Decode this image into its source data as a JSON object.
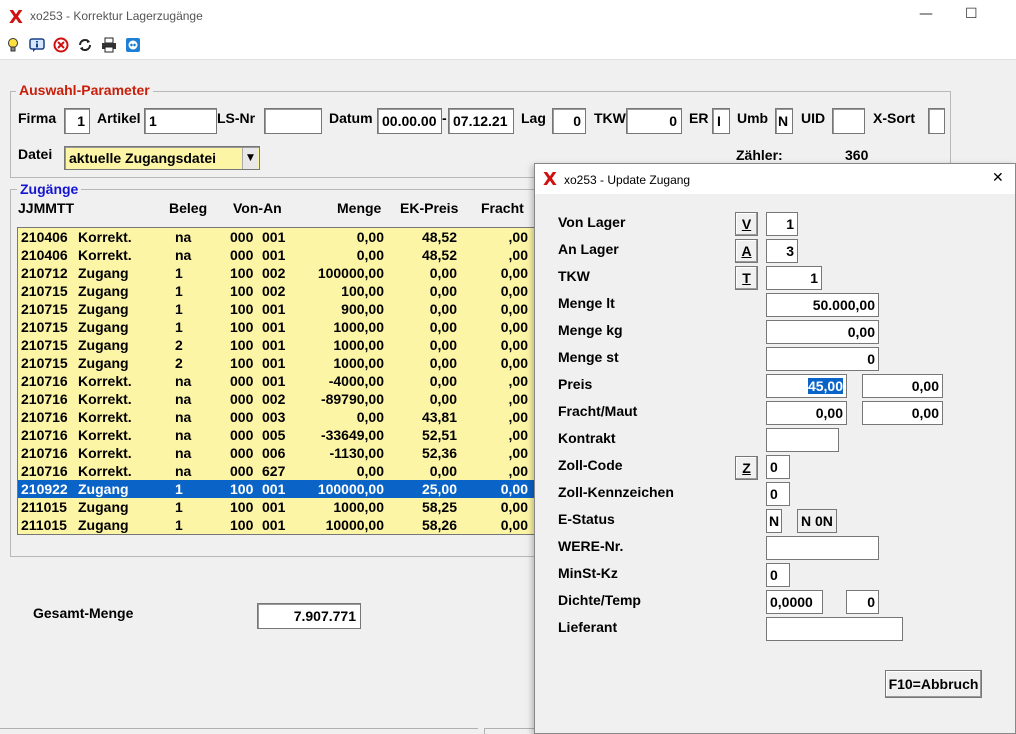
{
  "window": {
    "title": "xo253 - Korrektur Lagerzugänge",
    "logo": "X",
    "min": "—",
    "max": "☐"
  },
  "toolbar": {
    "icons": [
      "bulb-icon",
      "info-icon",
      "cancel-icon",
      "refresh-icon",
      "print-icon",
      "teamviewer-icon"
    ]
  },
  "params": {
    "legend": "Auswahl-Parameter",
    "firma_label": "Firma",
    "firma": "1",
    "artikel_label": "Artikel",
    "artikel": "1",
    "lsnr_label": "LS-Nr",
    "lsnr": "",
    "datum_label": "Datum",
    "datum_from": "00.00.00",
    "datum_sep": "-",
    "datum_to": "07.12.21",
    "lag_label": "Lag",
    "lag": "0",
    "tkw_label": "TKW",
    "tkw": "0",
    "er_label": "ER",
    "er": "I",
    "umb_label": "Umb",
    "umb": "N",
    "uid_label": "UID",
    "uid": "",
    "xsort_label": "X-Sort",
    "xsort": "",
    "datei_label": "Datei",
    "datei": "aktuelle Zugangsdatei",
    "zaehler_label": "Zähler:",
    "zaehler": "360"
  },
  "grid": {
    "legend": "Zugänge",
    "headers": {
      "date": "JJMMTT",
      "beleg": "Beleg",
      "vonan": "Von-An",
      "menge": "Menge",
      "ekpreis": "EK-Preis",
      "fracht": "Fracht"
    },
    "rows": [
      [
        "210406",
        "Korrekt.",
        "na",
        "000",
        "001",
        "0,00",
        "48,52",
        ",00"
      ],
      [
        "210406",
        "Korrekt.",
        "na",
        "000",
        "001",
        "0,00",
        "48,52",
        ",00"
      ],
      [
        "210712",
        "Zugang",
        "1",
        "100",
        "002",
        "100000,00",
        "0,00",
        "0,00"
      ],
      [
        "210715",
        "Zugang",
        "1",
        "100",
        "002",
        "100,00",
        "0,00",
        "0,00"
      ],
      [
        "210715",
        "Zugang",
        "1",
        "100",
        "001",
        "900,00",
        "0,00",
        "0,00"
      ],
      [
        "210715",
        "Zugang",
        "1",
        "100",
        "001",
        "1000,00",
        "0,00",
        "0,00"
      ],
      [
        "210715",
        "Zugang",
        "2",
        "100",
        "001",
        "1000,00",
        "0,00",
        "0,00"
      ],
      [
        "210715",
        "Zugang",
        "2",
        "100",
        "001",
        "1000,00",
        "0,00",
        "0,00"
      ],
      [
        "210716",
        "Korrekt.",
        "na",
        "000",
        "001",
        "-4000,00",
        "0,00",
        ",00"
      ],
      [
        "210716",
        "Korrekt.",
        "na",
        "000",
        "002",
        "-89790,00",
        "0,00",
        ",00"
      ],
      [
        "210716",
        "Korrekt.",
        "na",
        "000",
        "003",
        "0,00",
        "43,81",
        ",00"
      ],
      [
        "210716",
        "Korrekt.",
        "na",
        "000",
        "005",
        "-33649,00",
        "52,51",
        ",00"
      ],
      [
        "210716",
        "Korrekt.",
        "na",
        "000",
        "006",
        "-1130,00",
        "52,36",
        ",00"
      ],
      [
        "210716",
        "Korrekt.",
        "na",
        "000",
        "627",
        "0,00",
        "0,00",
        ",00"
      ],
      [
        "210922",
        "Zugang",
        "1",
        "100",
        "001",
        "100000,00",
        "25,00",
        "0,00"
      ],
      [
        "211015",
        "Zugang",
        "1",
        "100",
        "001",
        "1000,00",
        "58,25",
        "0,00"
      ],
      [
        "211015",
        "Zugang",
        "1",
        "100",
        "001",
        "10000,00",
        "58,26",
        "0,00"
      ]
    ],
    "selected_index": 14
  },
  "total": {
    "label": "Gesamt-Menge",
    "value": "7.907.771"
  },
  "dialog": {
    "logo": "X",
    "title": "xo253 - Update Zugang",
    "close": "✕",
    "von_lager_label": "Von Lager",
    "von_lager_btn": "V",
    "von_lager": "1",
    "an_lager_label": "An Lager",
    "an_lager_btn": "A",
    "an_lager": "3",
    "tkw_label": "TKW",
    "tkw_btn": "T",
    "tkw": "1",
    "menge_lt_label": "Menge lt",
    "menge_lt": "50.000,00",
    "menge_kg_label": "Menge kg",
    "menge_kg": "0,00",
    "menge_st_label": "Menge st",
    "menge_st": "0",
    "preis_label": "Preis",
    "preis": "45,00",
    "preis2": "0,00",
    "fracht_label": "Fracht/Maut",
    "fracht": "0,00",
    "fracht2": "0,00",
    "kontrakt_label": "Kontrakt",
    "kontrakt": "",
    "zollcode_label": "Zoll-Code",
    "zollcode_btn": "Z",
    "zollcode": "0",
    "zollkz_label": "Zoll-Kennzeichen",
    "zollkz": "0",
    "estatus_label": "E-Status",
    "estatus": "N",
    "estatus2": "N 0N",
    "werenr_label": "WERE-Nr.",
    "werenr": "",
    "minstkz_label": "MinSt-Kz",
    "minstkz": "0",
    "dichte_label": "Dichte/Temp",
    "dichte": "0,0000",
    "temp": "0",
    "lieferant_label": "Lieferant",
    "lieferant": "",
    "abbruch": "F10=Abbruch"
  }
}
